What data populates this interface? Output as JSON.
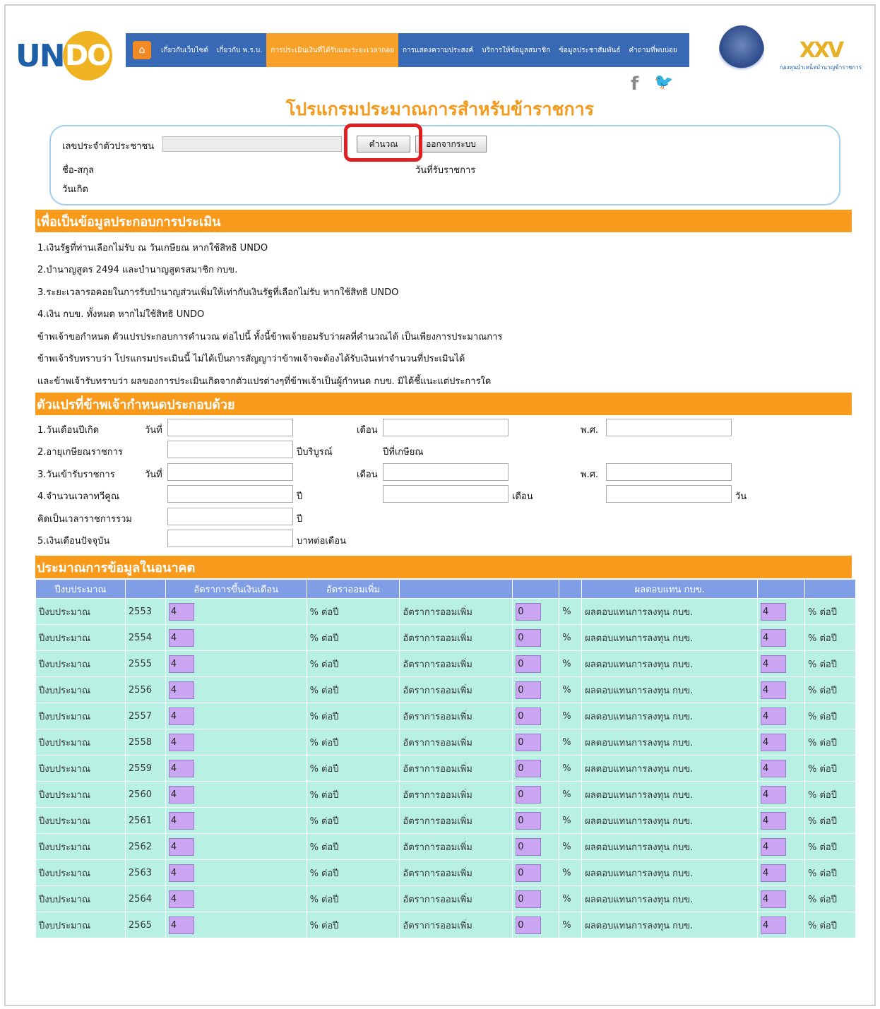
{
  "header": {
    "logo_un": "UN",
    "logo_do": "DO",
    "nav": [
      "เกี่ยวกับเว็บไซต์",
      "เกี่ยวกับ พ.ร.บ.",
      "การประเมินเงินที่ได้รับและระยะเวลาถอย",
      "การแสดงความประสงค์",
      "บริการให้ข้อมูลสมาชิก",
      "ข้อมูลประชาสัมพันธ์",
      "คำถามที่พบบ่อย"
    ],
    "social_facebook": "f",
    "social_twitter": "🐦",
    "fund_logo_mark": "XXV",
    "fund_logo_text": "กองทุนบำเหน็จบำนาญข้าราชการ",
    "page_title": "โปรแกรมประมาณการสำหรับข้าราชการ"
  },
  "idbox": {
    "id_label": "เลขประจำตัวประชาชน",
    "id_value": "",
    "calc_button": "คำนวณ",
    "logout_button": "ออกจากระบบ",
    "name_label": "ชื่อ-สกุล",
    "start_label": "วันที่รับราชการ",
    "birth_label": "วันเกิด"
  },
  "info": {
    "heading": "เพื่อเป็นข้อมูลประกอบการประเมิน",
    "lines": [
      "1.เงินรัฐที่ท่านเลือกไม่รับ ณ วันเกษียณ หากใช้สิทธิ UNDO",
      "2.บำนาญสูตร 2494 และบำนาญสูตรสมาชิก กบข.",
      "3.ระยะเวลารอคอยในการรับบำนาญส่วนเพิ่มให้เท่ากับเงินรัฐที่เลือกไม่รับ หากใช้สิทธิ UNDO",
      "4.เงิน กบข. ทั้งหมด หากไม่ใช้สิทธิ UNDO",
      "ข้าพเจ้าขอกำหนด ตัวแปรประกอบการคำนวณ ต่อไปนี้ ทั้งนี้ข้าพเจ้ายอมรับว่าผลที่คำนวณได้ เป็นเพียงการประมาณการ",
      "ข้าพเจ้ารับทราบว่า โปรแกรมประเมินนี้ ไม่ได้เป็นการสัญญาว่าข้าพเจ้าจะต้องได้รับเงินเท่าจำนวนที่ประเมินได้",
      "และข้าพเจ้ารับทราบว่า ผลของการประเมินเกิดจากตัวแปรต่างๆที่ข้าพเจ้าเป็นผู้กำหนด กบข. มิได้ชี้แนะแต่ประการใด"
    ]
  },
  "vars": {
    "heading": "ตัวแปรที่ข้าพเจ้ากำหนดประกอบด้วย",
    "birth": "1.วันเดือนปีเกิด",
    "day": "วันที่",
    "month": "เดือน",
    "year": "พ.ศ.",
    "retire_age": "2.อายุเกษียณราชการ",
    "full_year": "ปีบริบูรณ์",
    "retire_year": "ปีที่เกษียณ",
    "start_service": "3.วันเข้ารับราชการ",
    "leave_time": "4.จำนวนเวลาทวีคูณ",
    "unit_year": "ปี",
    "unit_month": "เดือน",
    "unit_day": "วัน",
    "total_service": "คิดเป็นเวลาราชการรวม",
    "salary": "5.เงินเดือนปัจจุบัน",
    "per_month": "บาทต่อเดือน"
  },
  "future": {
    "heading": "ประมาณการข้อมูลในอนาคต",
    "headers": [
      "ปีงบประมาณ",
      "",
      "อัตราการขึ้นเงินเดือน",
      "อัตราออมเพิ่ม",
      "",
      "",
      "",
      "ผลตอบแทน กบข.",
      "",
      ""
    ],
    "row_label": "ปีงบประมาณ",
    "pct_per_year": "% ต่อปี",
    "save_label": "อัตราการออมเพิ่ม",
    "pct": "%",
    "return_label": "ผลตอบแทนการลงทุน กบข.",
    "rows": [
      {
        "year": "2553",
        "raise": "4",
        "save": "0",
        "ret": "4"
      },
      {
        "year": "2554",
        "raise": "4",
        "save": "0",
        "ret": "4"
      },
      {
        "year": "2555",
        "raise": "4",
        "save": "0",
        "ret": "4"
      },
      {
        "year": "2556",
        "raise": "4",
        "save": "0",
        "ret": "4"
      },
      {
        "year": "2557",
        "raise": "4",
        "save": "0",
        "ret": "4"
      },
      {
        "year": "2558",
        "raise": "4",
        "save": "0",
        "ret": "4"
      },
      {
        "year": "2559",
        "raise": "4",
        "save": "0",
        "ret": "4"
      },
      {
        "year": "2560",
        "raise": "4",
        "save": "0",
        "ret": "4"
      },
      {
        "year": "2561",
        "raise": "4",
        "save": "0",
        "ret": "4"
      },
      {
        "year": "2562",
        "raise": "4",
        "save": "0",
        "ret": "4"
      },
      {
        "year": "2563",
        "raise": "4",
        "save": "0",
        "ret": "4"
      },
      {
        "year": "2564",
        "raise": "4",
        "save": "0",
        "ret": "4"
      },
      {
        "year": "2565",
        "raise": "4",
        "save": "0",
        "ret": "4"
      }
    ]
  }
}
